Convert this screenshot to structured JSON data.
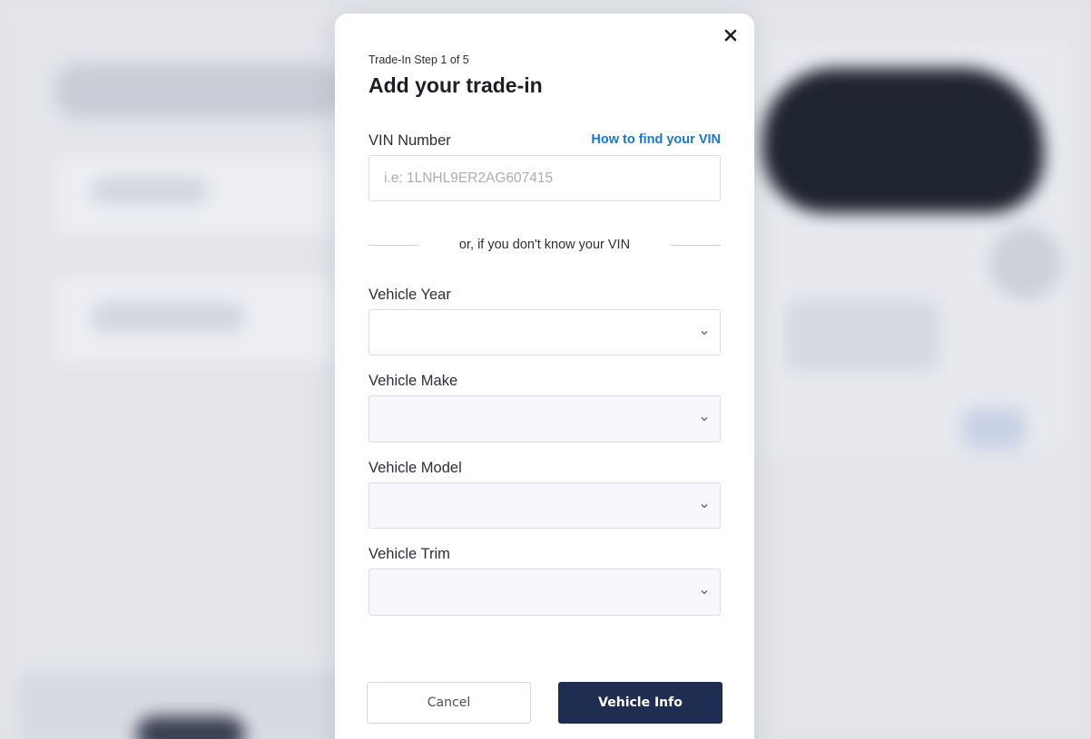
{
  "modal": {
    "step_label": "Trade-In Step 1 of 5",
    "title": "Add your trade-in",
    "close_icon": "close-icon"
  },
  "vin": {
    "label": "VIN Number",
    "help_link": "How to find your VIN",
    "placeholder": "i.e: 1LNHL9ER2AG607415",
    "value": ""
  },
  "divider": {
    "text": "or, if you don't know your VIN"
  },
  "fields": {
    "year": {
      "label": "Vehicle Year",
      "value": ""
    },
    "make": {
      "label": "Vehicle Make",
      "value": ""
    },
    "model": {
      "label": "Vehicle Model",
      "value": ""
    },
    "trim": {
      "label": "Vehicle Trim",
      "value": ""
    }
  },
  "actions": {
    "cancel_label": "Cancel",
    "next_label": "Vehicle Info"
  },
  "colors": {
    "primary": "#1f2d53",
    "link": "#1b78c9",
    "backdrop": "#dfe1e7"
  }
}
